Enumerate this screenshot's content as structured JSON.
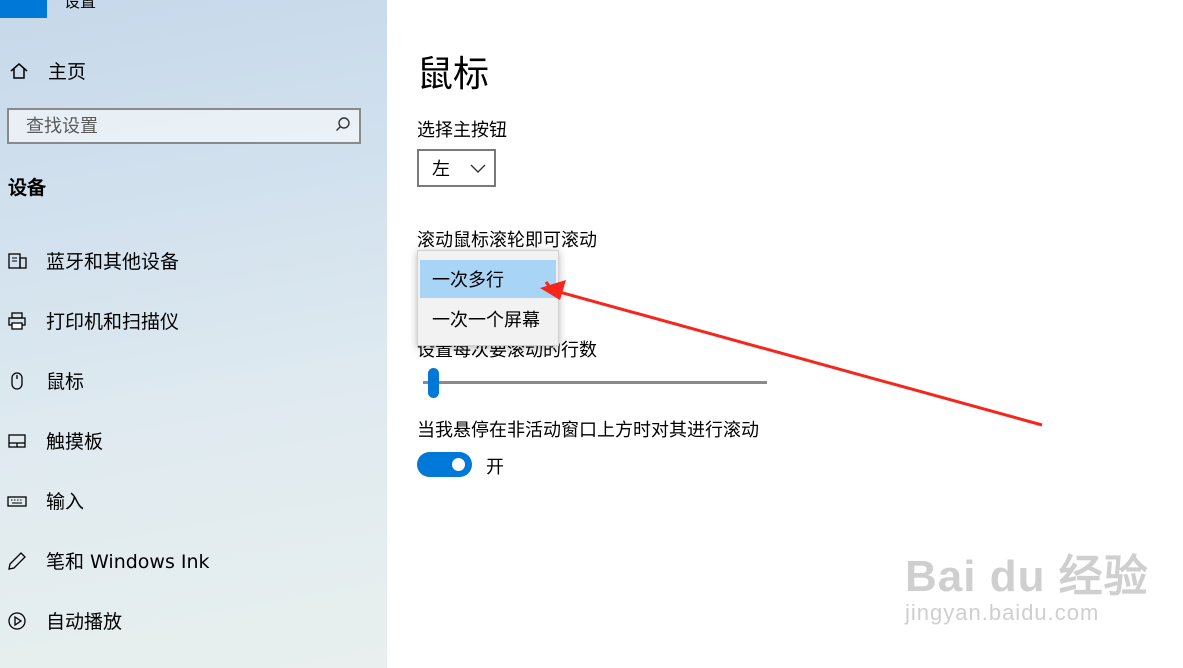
{
  "app_title": "设置",
  "sidebar": {
    "home_label": "主页",
    "search_placeholder": "查找设置",
    "section_title": "设备",
    "items": [
      {
        "label": "蓝牙和其他设备",
        "icon": "bluetooth-devices-icon"
      },
      {
        "label": "打印机和扫描仪",
        "icon": "printer-icon"
      },
      {
        "label": "鼠标",
        "icon": "mouse-icon"
      },
      {
        "label": "触摸板",
        "icon": "touchpad-icon"
      },
      {
        "label": "输入",
        "icon": "keyboard-icon"
      },
      {
        "label": "笔和 Windows Ink",
        "icon": "pen-icon"
      },
      {
        "label": "自动播放",
        "icon": "autoplay-icon"
      }
    ]
  },
  "main": {
    "title": "鼠标",
    "primary_button_label": "选择主按钮",
    "primary_button_value": "左",
    "scroll_label": "滚动鼠标滚轮即可滚动",
    "scroll_options": [
      "一次多行",
      "一次一个屏幕"
    ],
    "scroll_selected": "一次多行",
    "lines_label": "设置每次要滚动的行数",
    "lines_slider_fraction": 0.03,
    "inactive_scroll_label": "当我悬停在非活动窗口上方时对其进行滚动",
    "inactive_scroll_state": "开"
  },
  "annotation": {
    "arrow_color": "#f5261b"
  },
  "watermark": {
    "main": "Bai du 经验",
    "sub": "jingyan.baidu.com"
  },
  "colors": {
    "accent": "#0078d7",
    "selection": "#a8d4f5"
  }
}
